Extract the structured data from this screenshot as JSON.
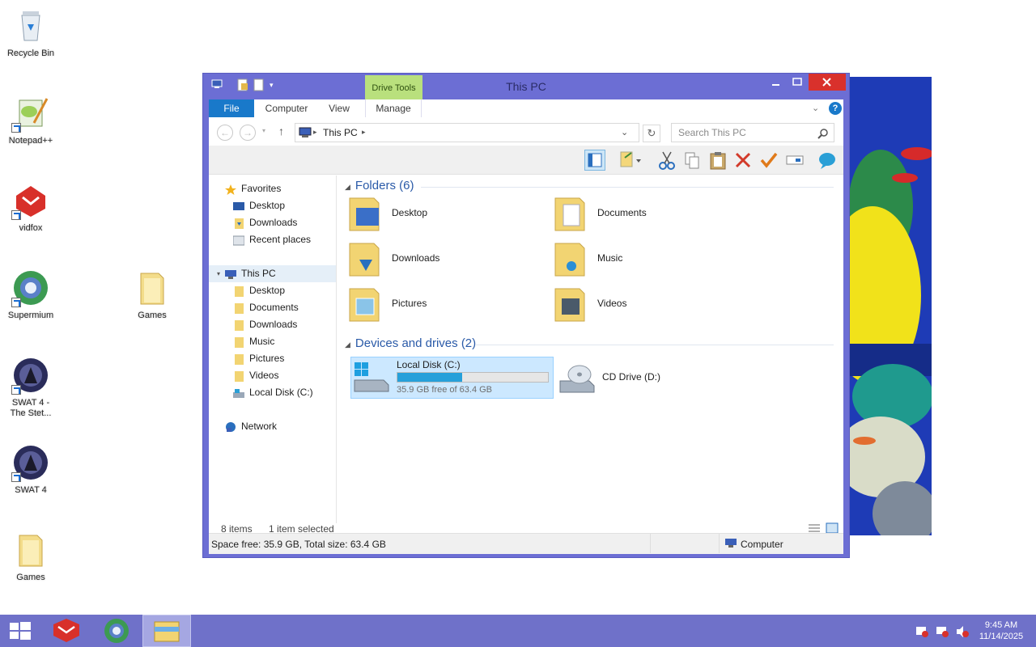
{
  "desktop": {
    "icons": [
      {
        "label": "Recycle Bin",
        "icon": "recycle-bin-icon"
      },
      {
        "label": "Notepad++",
        "icon": "notepad-plus-plus-icon"
      },
      {
        "label": "vidfox",
        "icon": "vidfox-icon"
      },
      {
        "label": "Supermium",
        "icon": "supermium-icon"
      },
      {
        "label": "Games",
        "icon": "folder-icon"
      },
      {
        "label": "SWAT 4 -",
        "label2": "The Stet...",
        "icon": "swat4-icon"
      },
      {
        "label": "SWAT 4",
        "icon": "swat4-icon"
      },
      {
        "label": "Games",
        "icon": "folder-icon"
      }
    ]
  },
  "window": {
    "title": "This PC",
    "context_tab": "Drive Tools",
    "tabs": [
      "File",
      "Computer",
      "View",
      "Manage"
    ],
    "address": {
      "location": "This PC"
    },
    "search": {
      "placeholder": "Search This PC"
    },
    "nav": {
      "favorites_label": "Favorites",
      "favorites": [
        "Desktop",
        "Downloads",
        "Recent places"
      ],
      "this_pc_label": "This PC",
      "this_pc": [
        "Desktop",
        "Documents",
        "Downloads",
        "Music",
        "Pictures",
        "Videos",
        "Local Disk (C:)"
      ],
      "network_label": "Network"
    },
    "folders_header": "Folders (6)",
    "folders": [
      "Desktop",
      "Documents",
      "Downloads",
      "Music",
      "Pictures",
      "Videos"
    ],
    "drives_header": "Devices and drives (2)",
    "drives": [
      {
        "name": "Local Disk (C:)",
        "free": "35.9 GB free of 63.4 GB",
        "used_fraction": 0.43
      },
      {
        "name": "CD Drive (D:)"
      }
    ],
    "status": {
      "items": "8 items",
      "selected": "1 item selected"
    },
    "details_bar": {
      "left": "Space free: 35.9 GB, Total size: 63.4 GB",
      "right": "Computer"
    }
  },
  "taskbar": {
    "time": "9:45 AM",
    "date": "11/14/2025"
  },
  "colors": {
    "accent": "#1979ca",
    "window_frame": "#6c6ed4",
    "taskbar": "#6f71c9",
    "drive_tools": "#b9e07d",
    "close": "#d9312c"
  }
}
